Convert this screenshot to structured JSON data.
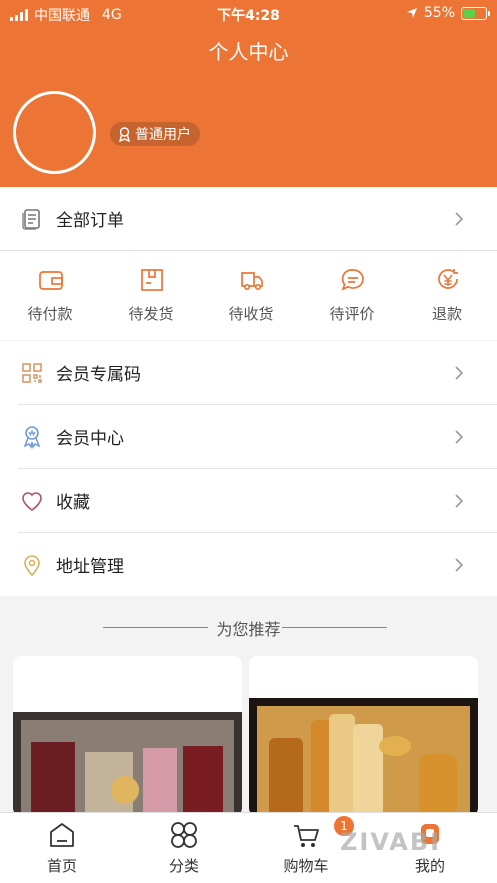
{
  "status_bar": {
    "carrier": "中国联通",
    "network": "4G",
    "time": "下午4:28",
    "battery": "55%",
    "battery_level": 0.55
  },
  "header": {
    "title": "个人中心",
    "user_badge": "普通用户",
    "accent_color": "#ec7535"
  },
  "orders_row": {
    "label": "全部订单"
  },
  "order_status": [
    {
      "label": "待付款",
      "icon": "wallet-icon"
    },
    {
      "label": "待发货",
      "icon": "package-icon"
    },
    {
      "label": "待收货",
      "icon": "truck-icon"
    },
    {
      "label": "待评价",
      "icon": "comment-icon"
    },
    {
      "label": "退款",
      "icon": "refund-icon"
    }
  ],
  "menu": [
    {
      "label": "会员专属码",
      "icon": "qr-code-icon"
    },
    {
      "label": "会员中心",
      "icon": "vip-medal-icon"
    },
    {
      "label": "收藏",
      "icon": "heart-icon"
    },
    {
      "label": "地址管理",
      "icon": "location-pin-icon"
    }
  ],
  "recommend": {
    "title": "为您推荐"
  },
  "tabbar": [
    {
      "label": "首页",
      "icon": "home-icon"
    },
    {
      "label": "分类",
      "icon": "category-icon"
    },
    {
      "label": "购物车",
      "icon": "cart-icon"
    },
    {
      "label": "我的",
      "icon": "profile-icon"
    }
  ],
  "cart_count": "1",
  "watermark": "ZIVABI"
}
